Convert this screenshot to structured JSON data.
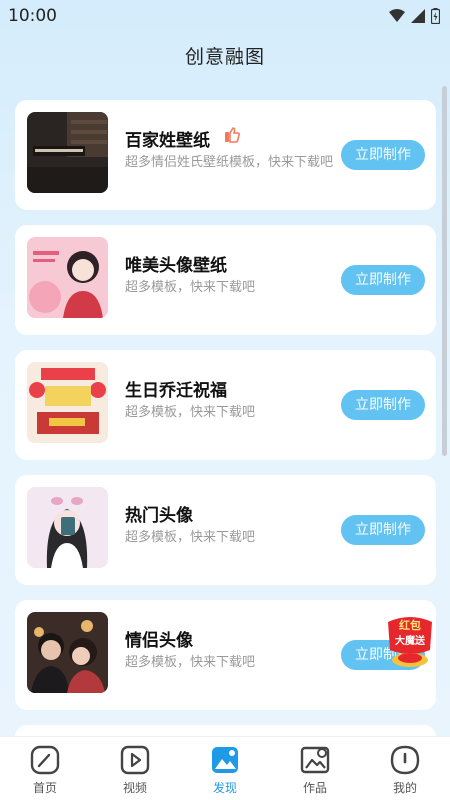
{
  "status": {
    "time": "10:00"
  },
  "header": {
    "title": "创意融图"
  },
  "cards": [
    {
      "title": "百家姓壁纸",
      "desc": "超多情侣姓氏壁纸模板，快来下载吧",
      "button": "立即制作",
      "thumb_icon": "surname-wallpaper-thumb",
      "hot": true
    },
    {
      "title": "唯美头像壁纸",
      "desc": "超多模板，快来下载吧",
      "button": "立即制作",
      "thumb_icon": "aesthetic-avatar-thumb"
    },
    {
      "title": "生日乔迁祝福",
      "desc": "超多模板，快来下载吧",
      "button": "立即制作",
      "thumb_icon": "birthday-blessing-thumb"
    },
    {
      "title": "热门头像",
      "desc": "超多模板，快来下载吧",
      "button": "立即制作",
      "thumb_icon": "popular-avatar-thumb"
    },
    {
      "title": "情侣头像",
      "desc": "超多模板，快来下载吧",
      "button": "立即制作",
      "thumb_icon": "couple-avatar-thumb"
    }
  ],
  "float_badge": {
    "line1": "红包",
    "line2": "大魔送"
  },
  "tabbar": {
    "items": [
      {
        "label": "首页",
        "icon": "home-icon"
      },
      {
        "label": "视频",
        "icon": "video-icon"
      },
      {
        "label": "发现",
        "icon": "discover-icon",
        "active": true
      },
      {
        "label": "作品",
        "icon": "works-icon"
      },
      {
        "label": "我的",
        "icon": "profile-icon"
      }
    ]
  },
  "colors": {
    "accent": "#62c2f1",
    "active_tab": "#1f9ae6",
    "background": "#d4ecfb"
  }
}
